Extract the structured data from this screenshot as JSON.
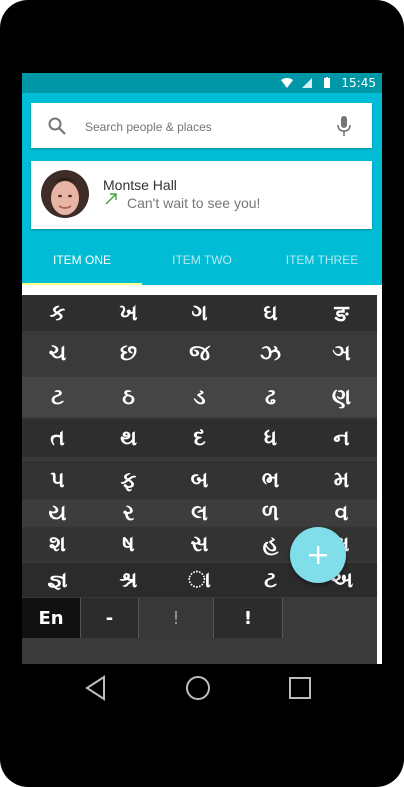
{
  "status_bar": {
    "time": "15:45"
  },
  "search": {
    "placeholder": "Search people & places"
  },
  "contact": {
    "name": "Montse Hall",
    "message": "Can't wait to see you!"
  },
  "tabs": [
    {
      "label": "ITEM ONE"
    },
    {
      "label": "ITEM TWO"
    },
    {
      "label": "ITEM THREE"
    }
  ],
  "keyboard": {
    "rows": [
      [
        "ક",
        "ખ",
        "ગ",
        "ઘ",
        "ङ"
      ],
      [
        "ચ",
        "છ",
        "જ",
        "ઝ",
        "ઞ"
      ],
      [
        "ટ",
        "ઠ",
        "ડ",
        "ઢ",
        "ણ"
      ],
      [
        "ત",
        "થ",
        "દ",
        "ધ",
        "ન"
      ],
      [
        "પ",
        "ફ",
        "બ",
        "ભ",
        "મ"
      ],
      [
        "ય",
        "ર",
        "લ",
        "ળ",
        "વ"
      ],
      [
        "શ",
        "ષ",
        "સ",
        "હ",
        "ક્ષ"
      ],
      [
        "જ્ઞ",
        "શ્ર",
        "◌ા",
        "ટ",
        "અ"
      ]
    ],
    "bottom": {
      "lang": "En",
      "dash": "-",
      "mark": "!",
      "excl": "!"
    }
  },
  "colors": {
    "primary": "#00bcd4",
    "primary_dark": "#0097a7",
    "accent": "#ffff8d",
    "fab": "#80deea"
  }
}
